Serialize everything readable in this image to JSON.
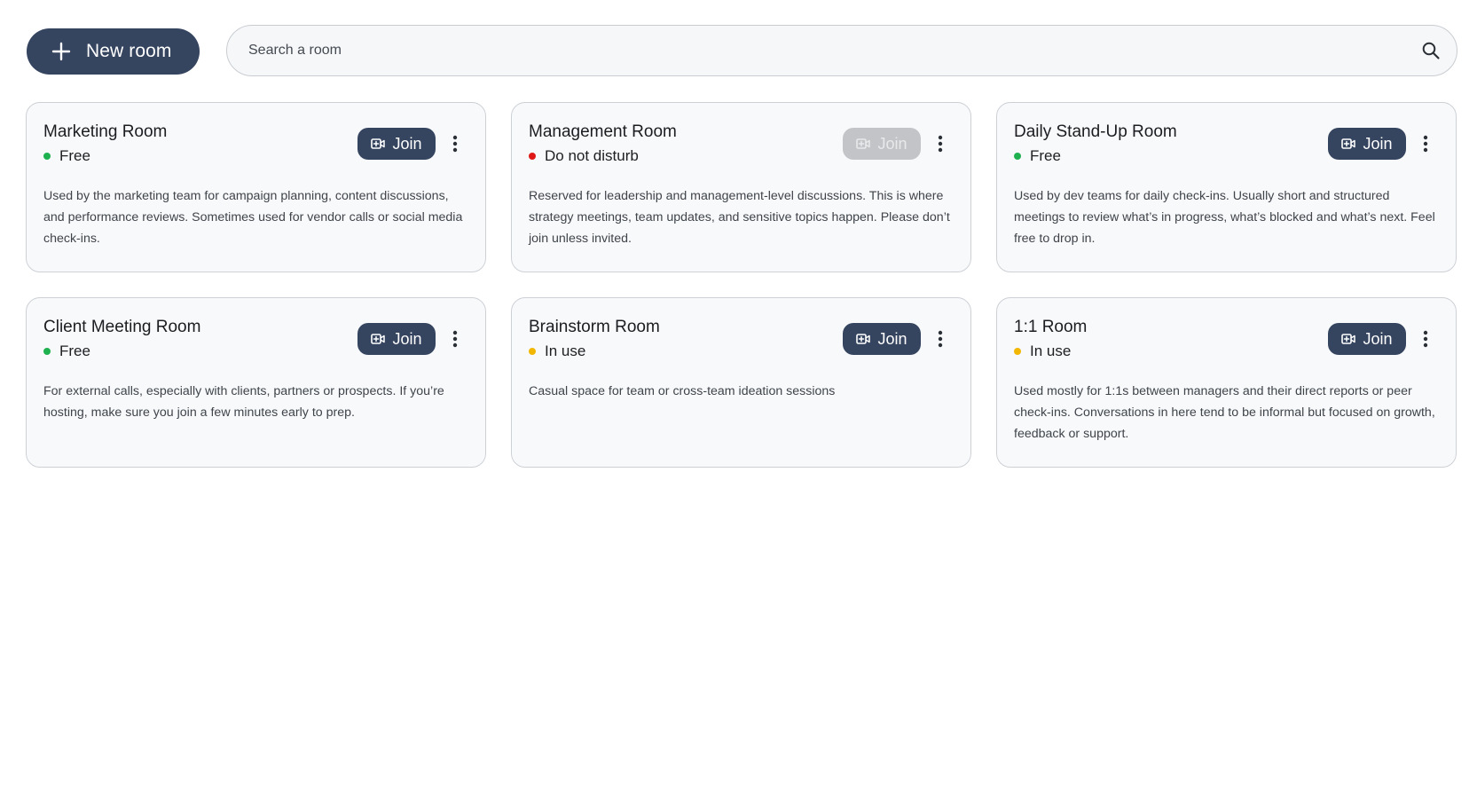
{
  "toolbar": {
    "new_room_label": "New room",
    "search_placeholder": "Search a room",
    "search_value": ""
  },
  "colors": {
    "primary": "#35445f",
    "status_free": "#1fb14f",
    "status_dnd": "#e01717",
    "status_in_use": "#f2b705",
    "disabled": "#c2c4c7"
  },
  "icons": {
    "new_room": "plus-icon",
    "search": "search-icon",
    "join": "video-icon",
    "more": "more-vertical-icon"
  },
  "rooms": [
    {
      "name": "Marketing Room",
      "status": "Free",
      "status_color": "#1fb14f",
      "join_label": "Join",
      "join_enabled": true,
      "description": "Used by the marketing team for campaign planning, content discussions, and performance reviews. Sometimes used for vendor calls or social media check-ins."
    },
    {
      "name": "Management Room",
      "status": "Do not disturb",
      "status_color": "#e01717",
      "join_label": "Join",
      "join_enabled": false,
      "description": "Reserved for leadership and management-level discussions. This is where strategy meetings, team updates, and sensitive topics happen. Please don’t join unless invited."
    },
    {
      "name": "Daily Stand-Up Room",
      "status": "Free",
      "status_color": "#1fb14f",
      "join_label": "Join",
      "join_enabled": true,
      "description": "Used by dev teams for daily check-ins. Usually short and structured meetings to review what’s in progress, what’s blocked and what’s next. Feel free to drop in."
    },
    {
      "name": "Client Meeting Room",
      "status": "Free",
      "status_color": "#1fb14f",
      "join_label": "Join",
      "join_enabled": true,
      "description": "For external calls, especially with clients, partners or prospects. If you’re hosting, make sure you join a few minutes early to prep."
    },
    {
      "name": "Brainstorm Room",
      "status": "In use",
      "status_color": "#f2b705",
      "join_label": "Join",
      "join_enabled": true,
      "description": "Casual space for team or cross-team ideation sessions"
    },
    {
      "name": "1:1 Room",
      "status": "In use",
      "status_color": "#f2b705",
      "join_label": "Join",
      "join_enabled": true,
      "description": "Used mostly for 1:1s between managers and their direct reports or peer check-ins. Conversations in here tend to be informal but focused on growth, feedback or support."
    }
  ]
}
